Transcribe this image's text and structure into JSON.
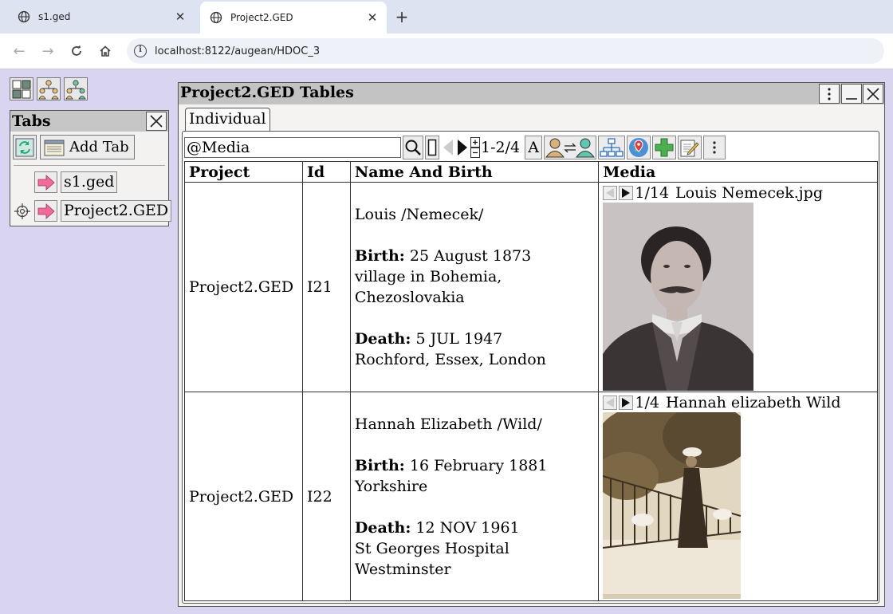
{
  "browser": {
    "tabs": [
      {
        "title": "s1.ged",
        "active": false
      },
      {
        "title": "Project2.GED",
        "active": true
      }
    ],
    "url": "localhost:8122/augean/HDOC_3"
  },
  "tabs_panel": {
    "title": "Tabs",
    "add_tab_label": "Add Tab",
    "items": [
      {
        "label": "s1.ged"
      },
      {
        "label": "Project2.GED"
      }
    ]
  },
  "main": {
    "title": "Project2.GED Tables",
    "subtab": "Individual",
    "filter_value": "@Media",
    "page_count": "1-2/4",
    "font_button": "A",
    "columns": [
      "Project",
      "Id",
      "Name And Birth",
      "Media"
    ],
    "rows": [
      {
        "project": "Project2.GED",
        "id": "I21",
        "name": "Louis /Nemecek/",
        "birth_label": "Birth:",
        "birth_date": "25 August 1873",
        "birth_place_1": "village in Bohemia,",
        "birth_place_2": "Chezoslovakia",
        "death_label": "Death:",
        "death_date": "5 JUL 1947",
        "death_place_1": "Rochford, Essex, London",
        "death_place_2": "",
        "media_counter": "1/14",
        "media_title": "Louis Nemecek.jpg"
      },
      {
        "project": "Project2.GED",
        "id": "I22",
        "name": "Hannah Elizabeth /Wild/",
        "birth_label": "Birth:",
        "birth_date": "16 February 1881",
        "birth_place_1": "Yorkshire",
        "birth_place_2": "",
        "death_label": "Death:",
        "death_date": "12 NOV 1961",
        "death_place_1": "St Georges Hospital Westminster",
        "death_place_2": "",
        "media_counter": "1/4",
        "media_title": "Hannah elizabeth Wild"
      }
    ]
  }
}
